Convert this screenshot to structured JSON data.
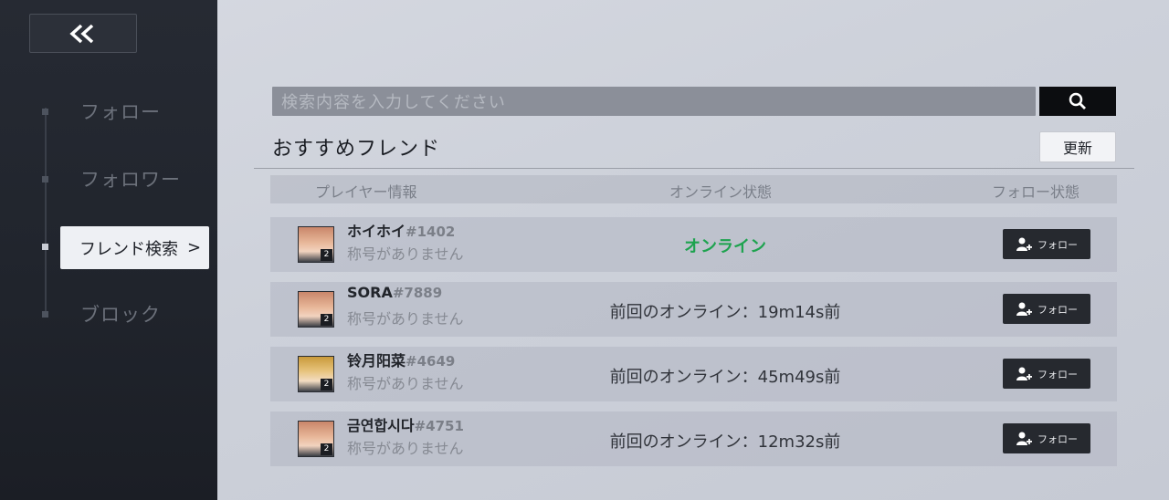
{
  "sidebar": {
    "back_icon": "double-chevron-left-icon",
    "items": [
      {
        "label": "フォロー"
      },
      {
        "label": "フォロワー"
      },
      {
        "label": "フレンド検索",
        "active": true
      },
      {
        "label": "ブロック"
      }
    ],
    "active_chevron": ">"
  },
  "search": {
    "placeholder": "検索内容を入力してください",
    "icon": "search-icon"
  },
  "section": {
    "title": "おすすめフレンド",
    "refresh_label": "更新"
  },
  "table": {
    "headers": [
      "プレイヤー情報",
      "オンライン状態",
      "フォロー状態"
    ],
    "rows": [
      {
        "name": "ホイホイ",
        "tag": "#1402",
        "title": "称号がありません",
        "level": "2",
        "status": "オンライン",
        "online": true,
        "follow_label": "フォロー"
      },
      {
        "name": "SORA",
        "tag": "#7889",
        "title": "称号がありません",
        "level": "2",
        "status": "前回のオンライン：19m14s前",
        "online": false,
        "follow_label": "フォロー"
      },
      {
        "name": "铃月阳菜",
        "tag": "#4649",
        "title": "称号がありません",
        "level": "2",
        "status": "前回のオンライン：45m49s前",
        "online": false,
        "follow_label": "フォロー"
      },
      {
        "name": "금연합시다",
        "tag": "#4751",
        "title": "称号がありません",
        "level": "2",
        "status": "前回のオンライン：12m32s前",
        "online": false,
        "follow_label": "フォロー"
      }
    ]
  },
  "colors": {
    "online": "#1ea34f",
    "sidebar_bg": "#23272f",
    "accent_dark": "#0c0d10"
  }
}
